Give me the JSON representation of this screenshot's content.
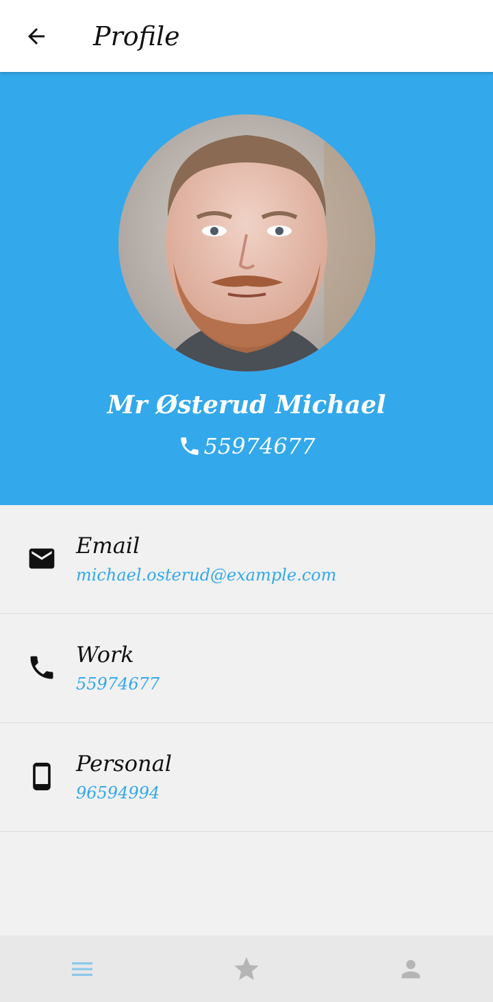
{
  "appbar": {
    "title": "Profile",
    "back_icon": "arrow-left-icon"
  },
  "profile": {
    "name": "Mr Østerud Michael",
    "phone": "55974677",
    "phone_icon": "phone-icon",
    "header_color": "#33a8eb"
  },
  "contacts": [
    {
      "icon": "mail-icon",
      "label": "Email",
      "value": "michael.osterud@example.com"
    },
    {
      "icon": "phone-icon",
      "label": "Work",
      "value": "55974677"
    },
    {
      "icon": "smartphone-icon",
      "label": "Personal",
      "value": "96594994"
    }
  ],
  "bottom_nav": {
    "items": [
      {
        "icon": "menu-icon",
        "active": true,
        "color": "#8cc8ea"
      },
      {
        "icon": "star-icon",
        "active": false,
        "color": "#b5b5b5"
      },
      {
        "icon": "person-icon",
        "active": false,
        "color": "#b5b5b5"
      }
    ]
  }
}
